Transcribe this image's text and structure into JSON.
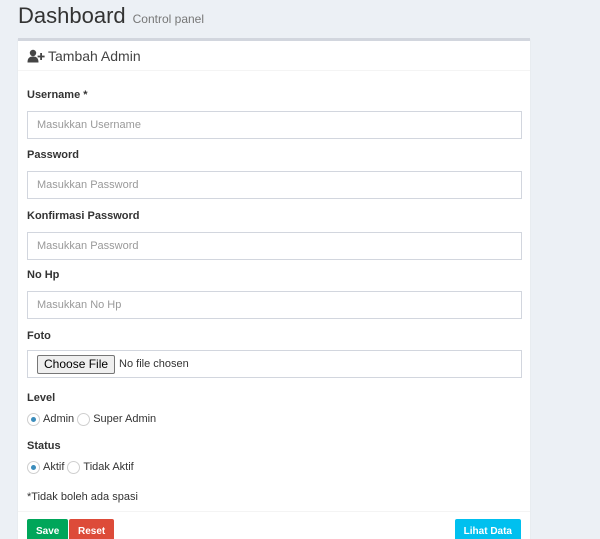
{
  "header": {
    "title": "Dashboard",
    "subtitle": "Control panel"
  },
  "form": {
    "title": "Tambah Admin",
    "icon": "user-plus-icon",
    "username": {
      "label": "Username *",
      "placeholder": "Masukkan Username"
    },
    "password": {
      "label": "Password",
      "placeholder": "Masukkan Password"
    },
    "confirm_password": {
      "label": "Konfirmasi Password",
      "placeholder": "Masukkan Password"
    },
    "phone": {
      "label": "No Hp",
      "placeholder": "Masukkan No Hp"
    },
    "photo": {
      "label": "Foto",
      "button": "Choose File",
      "status": "No file chosen"
    },
    "level": {
      "label": "Level",
      "options": [
        "Admin",
        "Super Admin"
      ],
      "selected": "Admin"
    },
    "status": {
      "label": "Status",
      "options": [
        "Aktif",
        "Tidak Aktif"
      ],
      "selected": "Aktif"
    },
    "note": "*Tidak boleh ada spasi"
  },
  "footer": {
    "save_label": "Save",
    "reset_label": "Reset",
    "view_label": "Lihat Data"
  },
  "colors": {
    "save": "#00a65a",
    "reset": "#dd4b39",
    "view": "#00c0ef",
    "radio_checked": "#3c8dbc"
  }
}
